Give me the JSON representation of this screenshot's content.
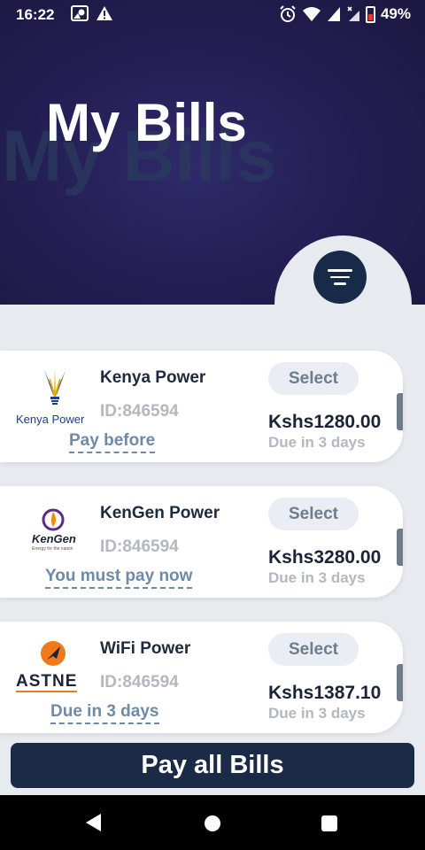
{
  "status_bar": {
    "time": "16:22",
    "battery": "49%",
    "icons": [
      "image-icon",
      "warning-icon",
      "alarm-icon",
      "wifi-icon",
      "signal-icon",
      "signal-x-icon",
      "battery-icon"
    ]
  },
  "header": {
    "title": "My Bills",
    "ghost_title": "My Bills",
    "filter_icon": "filter-icon"
  },
  "bills": [
    {
      "provider": "Kenya Power",
      "logo_text": "Kenya Power",
      "id": "ID:846594",
      "note": "Pay before",
      "select_label": "Select",
      "amount": "Kshs1280.00",
      "due": "Due in 3 days"
    },
    {
      "provider": "KenGen Power",
      "logo_text": "KenGen",
      "logo_subtext": "Energy for the nation",
      "id": "ID:846594",
      "note": "You must pay now",
      "select_label": "Select",
      "amount": "Kshs3280.00",
      "due": "Due in 3 days"
    },
    {
      "provider": "WiFi Power",
      "logo_text": "ASTNE",
      "id": "ID:846594",
      "note": "Due in 3 days",
      "select_label": "Select",
      "amount": "Kshs1387.10",
      "due": "Due in 3 days"
    }
  ],
  "footer": {
    "pay_all_label": "Pay all Bills"
  },
  "colors": {
    "header_bg": "#241f55",
    "accent_dark": "#1b2a47",
    "note_blue": "#6e8aa6",
    "muted_gray": "#b3b8c0"
  }
}
